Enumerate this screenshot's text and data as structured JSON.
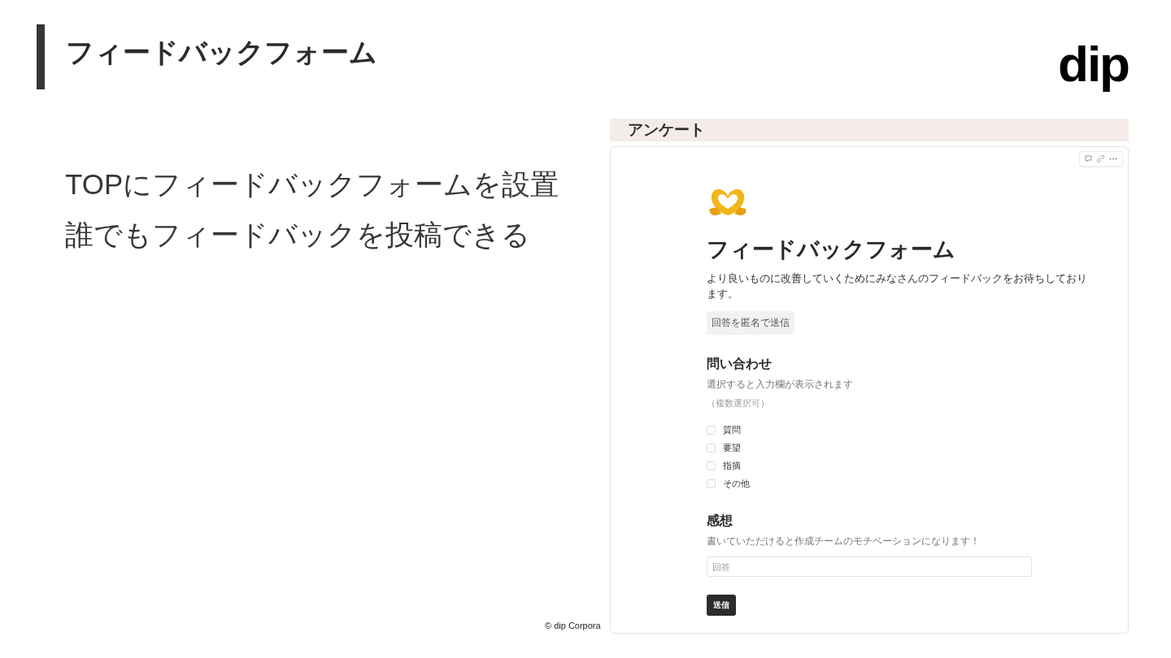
{
  "slide": {
    "title": "フィードバックフォーム",
    "logo": "dip",
    "bullets": [
      "TOPにフィードバックフォームを設置",
      "誰でもフィードバックを投稿できる"
    ],
    "footer": "© dip Corpora"
  },
  "screenshot": {
    "header": "アンケート",
    "form": {
      "title": "フィードバックフォーム",
      "description": "より良いものに改善していくためにみなさんのフィードバックをお待ちしております。",
      "anonymous_button": "回答を匿名で送信",
      "questions": [
        {
          "kind": "checkboxes",
          "title": "問い合わせ",
          "hint": "選択すると入力欄が表示されます",
          "note": "（複数選択可）",
          "options": [
            {
              "label": "質問",
              "checked": false
            },
            {
              "label": "要望",
              "checked": false
            },
            {
              "label": "指摘",
              "checked": false
            },
            {
              "label": "その他",
              "checked": false
            }
          ]
        },
        {
          "kind": "text",
          "title": "感想",
          "hint": "書いていただけると作成チームのモチベーションになります！",
          "placeholder": "回答"
        }
      ],
      "submit": "送信"
    }
  }
}
